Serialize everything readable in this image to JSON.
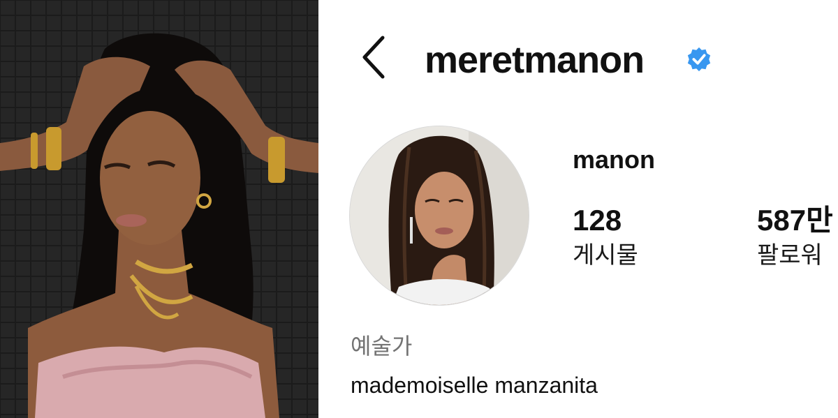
{
  "profile": {
    "handle": "meretmanon",
    "verified": true,
    "display_name": "manon",
    "category": "예술가",
    "bio": "mademoiselle manzanita"
  },
  "stats": {
    "posts": {
      "value": "128",
      "label": "게시물"
    },
    "followers": {
      "value": "587만",
      "label": "팔로워"
    }
  },
  "icons": {
    "back": "chevron-left-icon",
    "verified": "verified-badge-icon"
  },
  "colors": {
    "verified_blue": "#3897f0",
    "category_gray": "#737373",
    "text_black": "#111111"
  }
}
